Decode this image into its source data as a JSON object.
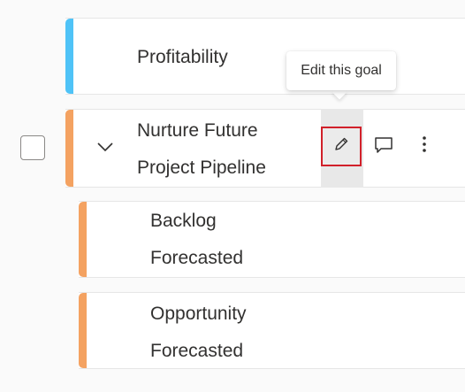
{
  "colors": {
    "accent_blue": "#4fc3f7",
    "accent_orange": "#f4a261",
    "highlight_border": "#d1202a"
  },
  "goals": [
    {
      "title_line1": "Profitability",
      "title_line2": ""
    },
    {
      "title_line1": "Nurture Future",
      "title_line2": "Project Pipeline"
    },
    {
      "title_line1": "Backlog",
      "title_line2": "Forecasted"
    },
    {
      "title_line1": "Opportunity",
      "title_line2": "Forecasted"
    }
  ],
  "tooltip": {
    "text": "Edit this goal"
  },
  "icons": {
    "expand": "chevron-down-icon",
    "edit": "pencil-icon",
    "comment": "comment-icon",
    "more": "more-vertical-icon"
  }
}
